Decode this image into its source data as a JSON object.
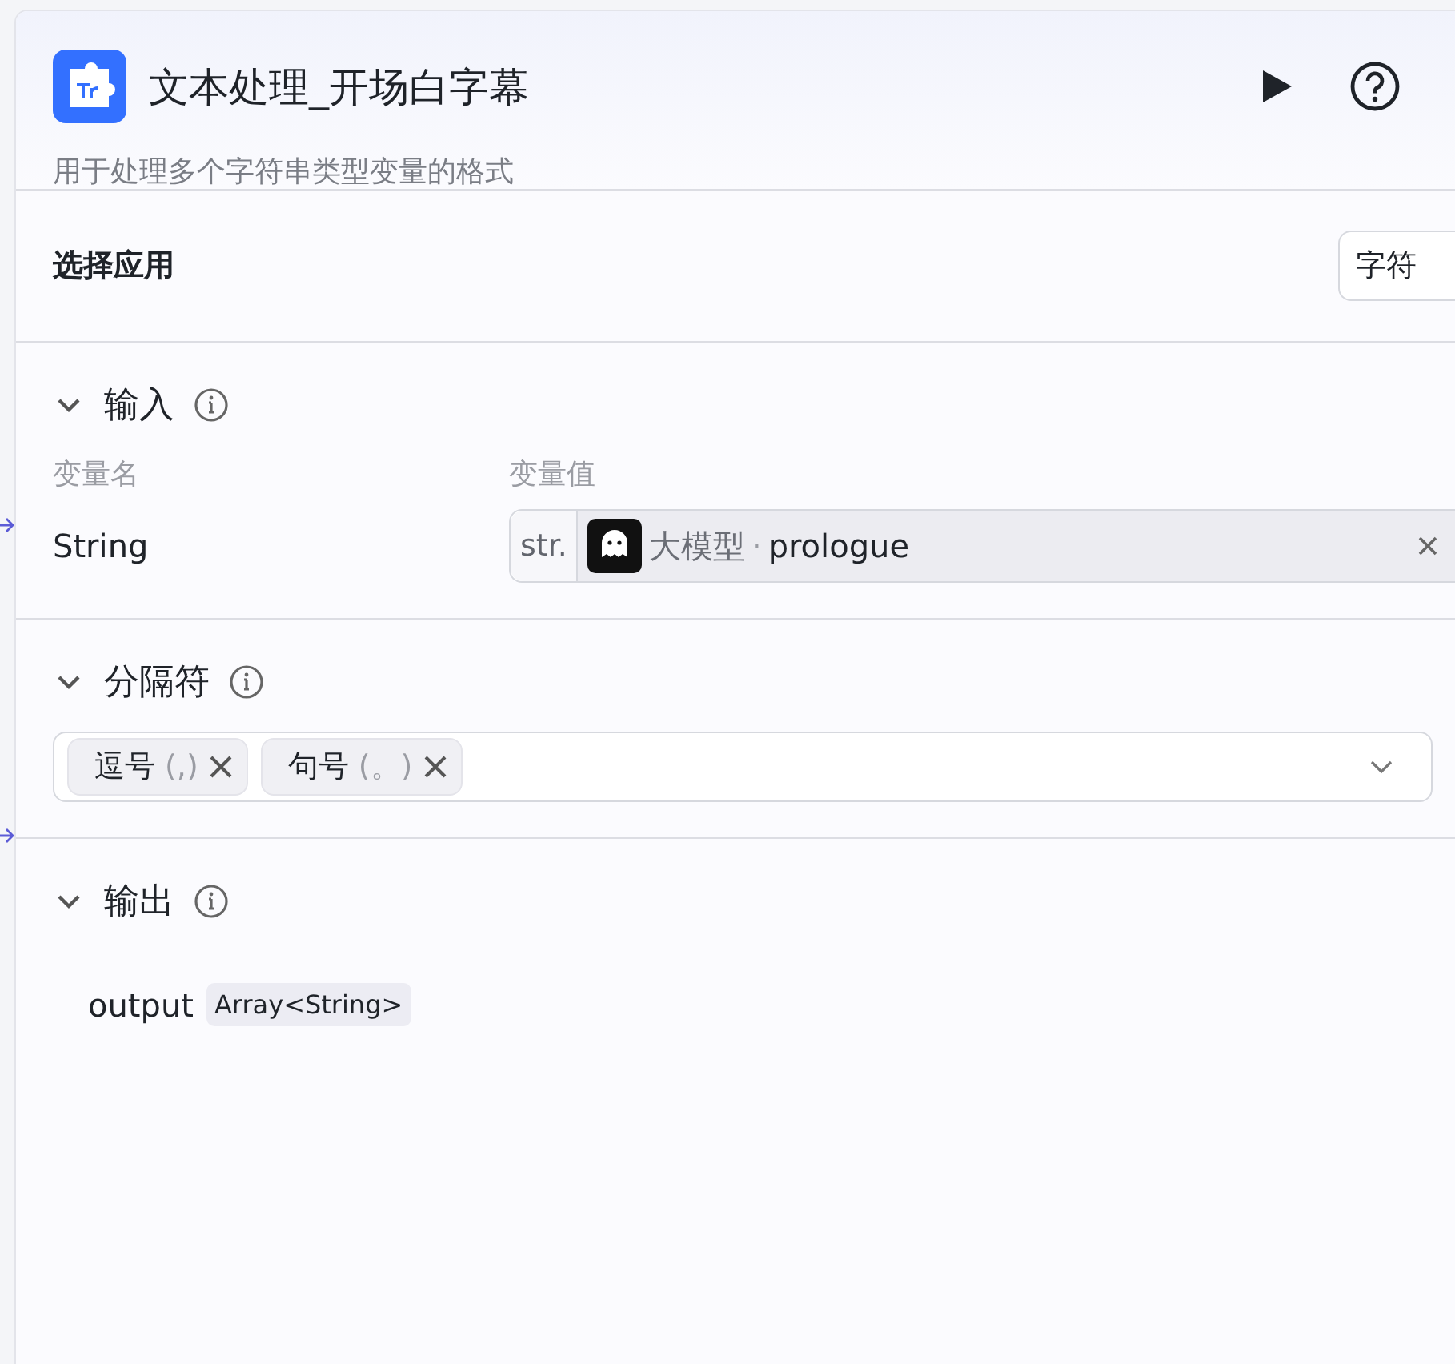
{
  "header": {
    "title": "文本处理_开场白字幕",
    "description": "用于处理多个字符串类型变量的格式"
  },
  "app_select": {
    "label": "选择应用",
    "value": "字符"
  },
  "input": {
    "title": "输入",
    "expanded": true,
    "columns": [
      "变量名",
      "变量值"
    ],
    "rows": [
      {
        "name": "String",
        "type_tag": "str.",
        "source": "大模型",
        "separator": "·",
        "variable": "prologue"
      }
    ]
  },
  "delimiter": {
    "title": "分隔符",
    "expanded": true,
    "tags": [
      {
        "label": "逗号",
        "symbol": "(,)"
      },
      {
        "label": "句号",
        "symbol": "(。)"
      }
    ]
  },
  "output": {
    "title": "输出",
    "expanded": true,
    "rows": [
      {
        "name": "output",
        "type": "Array<String>"
      }
    ]
  }
}
